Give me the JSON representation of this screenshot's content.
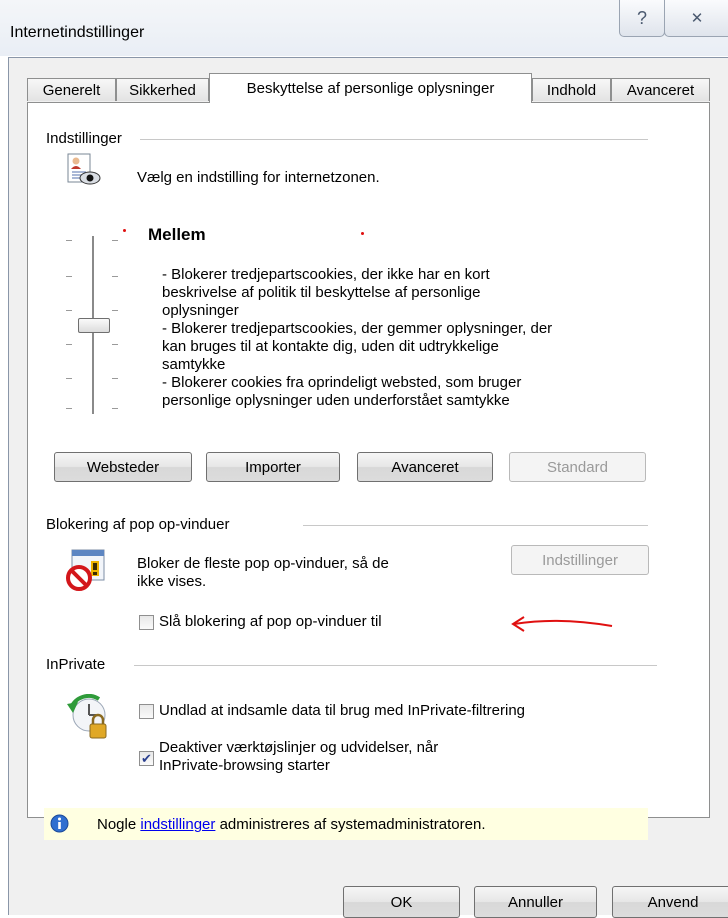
{
  "window": {
    "title": "Internetindstillinger",
    "help_symbol": "?",
    "close_symbol": "✕"
  },
  "tabs": [
    {
      "label": "Generelt"
    },
    {
      "label": "Sikkerhed"
    },
    {
      "label": "Beskyttelse af personlige oplysninger",
      "active": true
    },
    {
      "label": "Indhold"
    },
    {
      "label": "Avanceret"
    }
  ],
  "settings": {
    "group_label": "Indstillinger",
    "intro": "Vælg en indstilling for internetzonen.",
    "level": "Mellem",
    "slider_level_fraction": 0.5,
    "description": [
      "- Blokerer tredjepartscookies, der ikke har en kort",
      "beskrivelse af politik til beskyttelse af personlige",
      "oplysninger",
      "- Blokerer tredjepartscookies, der gemmer oplysninger, der",
      "kan bruges til at kontakte dig, uden dit udtrykkelige",
      "samtykke",
      "- Blokerer cookies fra oprindeligt websted, som bruger",
      "personlige oplysninger uden underforstået samtykke"
    ],
    "buttons": {
      "sites": "Websteder",
      "import": "Importer",
      "advanced": "Avanceret",
      "default": "Standard"
    }
  },
  "popup": {
    "group_label": "Blokering af pop op-vinduer",
    "text_line1": "Bloker de fleste pop op-vinduer, så de",
    "text_line2": "ikke vises.",
    "settings_button": "Indstillinger",
    "checkbox_label": "Slå blokering af pop op-vinduer til",
    "checkbox_checked": false
  },
  "inprivate": {
    "group_label": "InPrivate",
    "checkbox1_label": "Undlad at indsamle data til brug med InPrivate-filtrering",
    "checkbox1_checked": false,
    "checkbox2_line1": "Deaktiver værktøjslinjer og udvidelser, når",
    "checkbox2_line2": "InPrivate-browsing starter",
    "checkbox2_checked": true
  },
  "info": {
    "prefix": "Nogle ",
    "link": "indstillinger",
    "suffix": " administreres af systemadministratoren."
  },
  "footer": {
    "ok": "OK",
    "cancel": "Annuller",
    "apply": "Anvend"
  },
  "colors": {
    "annotation_red": "#e01010",
    "info_bg": "#ffffe1",
    "link": "#0000ee"
  }
}
